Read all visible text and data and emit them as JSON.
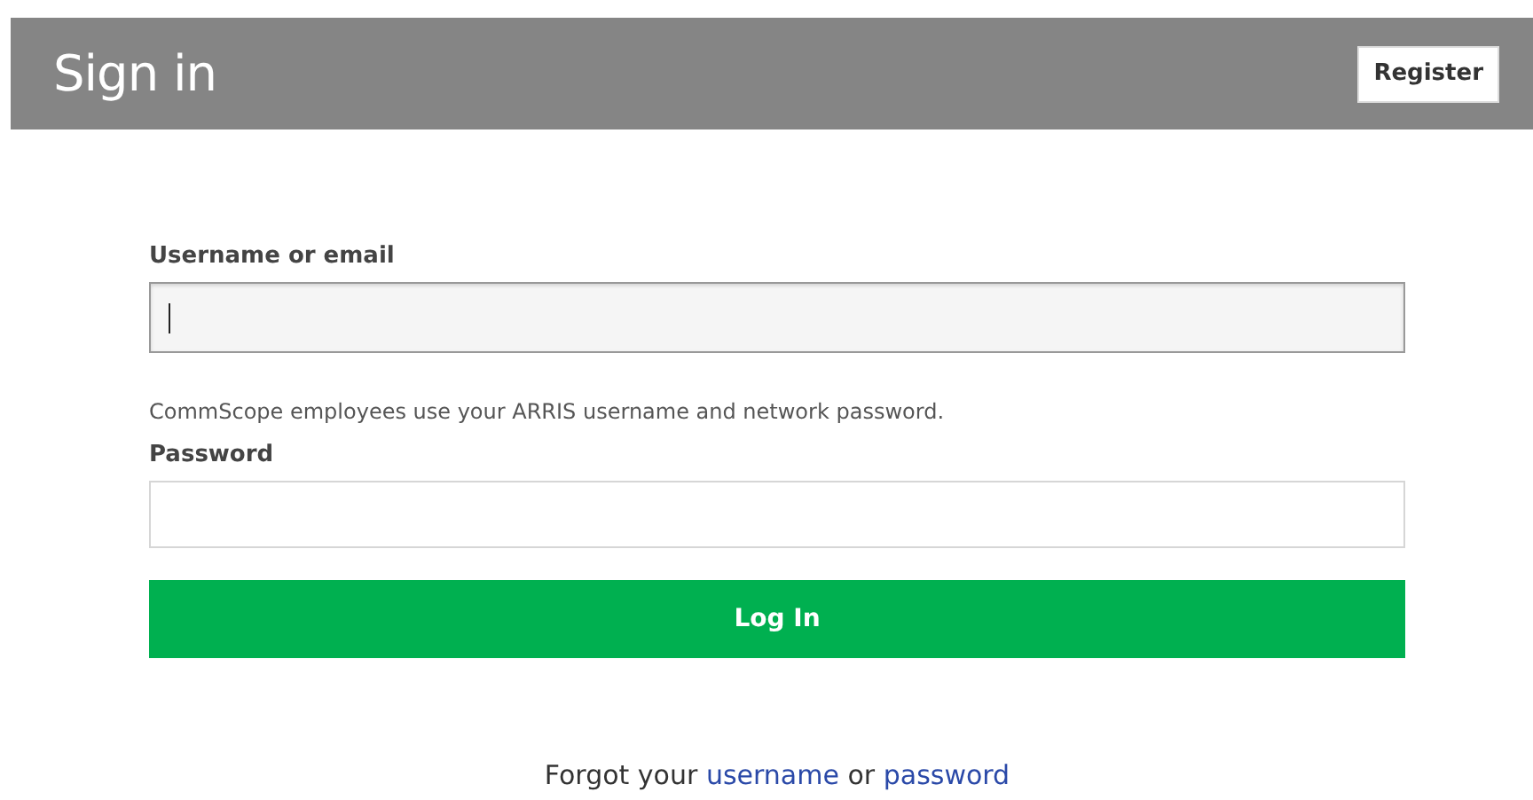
{
  "header": {
    "title": "Sign in",
    "register_button": "Register"
  },
  "form": {
    "fields": [
      {
        "label": "Username or email",
        "focused": true
      },
      {
        "label": "Password",
        "focused": false
      }
    ],
    "hint": "CommScope employees use your ARRIS username and network password.",
    "submit": "Log In"
  },
  "forgot": [
    {
      "kind": "text",
      "text": "Forgot your"
    },
    {
      "kind": "link",
      "text": "username"
    },
    {
      "kind": "text",
      "text": "or"
    },
    {
      "kind": "link",
      "text": "password"
    }
  ]
}
